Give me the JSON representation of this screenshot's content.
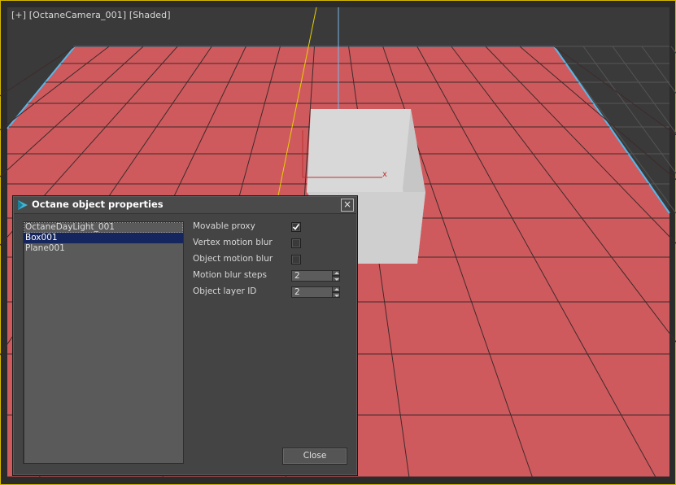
{
  "viewport": {
    "label": "[+] [OctaneCamera_001] [Shaded]",
    "axis_label": "x",
    "colors": {
      "ground": "#d05a5e",
      "background": "#3a3a3a",
      "box": "#d6d6d6",
      "highlight_border": "#dcc000"
    }
  },
  "dialog": {
    "title": "Octane object properties",
    "close_glyph": "×",
    "objects": [
      "OctaneDayLight_001",
      "Box001",
      "Plane001"
    ],
    "selected_object": "Box001",
    "properties": {
      "movable_proxy": {
        "label": "Movable proxy",
        "checked": true
      },
      "vertex_motion_blur": {
        "label": "Vertex motion blur",
        "checked": false
      },
      "object_motion_blur": {
        "label": "Object motion blur",
        "checked": false
      },
      "motion_blur_steps": {
        "label": "Motion blur steps",
        "value": "2"
      },
      "object_layer_id": {
        "label": "Object layer ID",
        "value": "2"
      }
    },
    "close_label": "Close"
  }
}
